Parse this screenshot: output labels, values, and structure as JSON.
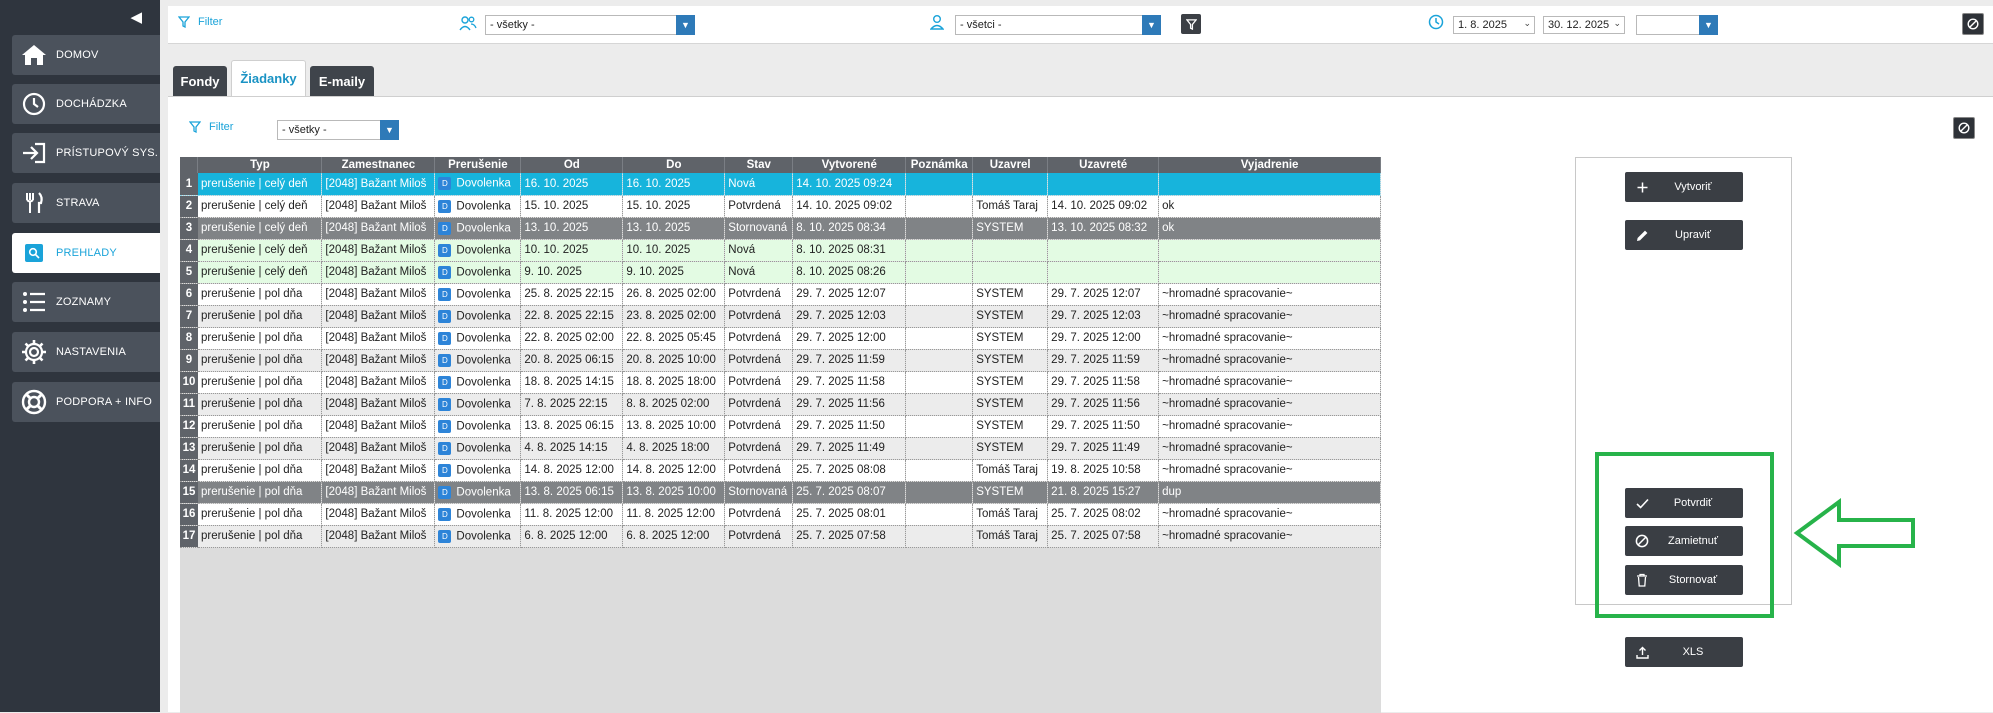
{
  "sidebar": {
    "items": [
      {
        "label": "DOMOV",
        "icon": "home-icon"
      },
      {
        "label": "DOCHÁDZKA",
        "icon": "clock-icon"
      },
      {
        "label": "PRÍSTUPOVÝ SYS.",
        "icon": "login-icon"
      },
      {
        "label": "STRAVA",
        "icon": "cutlery-icon"
      },
      {
        "label": "PREHĽADY",
        "icon": "search-icon"
      },
      {
        "label": "ZOZNAMY",
        "icon": "list-icon"
      },
      {
        "label": "NASTAVENIA",
        "icon": "gear-icon"
      },
      {
        "label": "PODPORA + INFO",
        "icon": "lifebuoy-icon"
      }
    ],
    "active_index": 4
  },
  "topbar": {
    "filter_label": "Filter",
    "group_select": "- všetky -",
    "person_select": "- všetci -",
    "date_from": "1. 8. 2025",
    "date_to": "30. 12. 2025",
    "extra_select": ""
  },
  "tabs": [
    {
      "label": "Fondy",
      "active": false
    },
    {
      "label": "Žiadanky",
      "active": true
    },
    {
      "label": "E-maily",
      "active": false
    }
  ],
  "panel_filter": {
    "label": "Filter",
    "select": "- všetky -"
  },
  "grid": {
    "columns": [
      "Typ",
      "Zamestnanec",
      "Prerušenie",
      "Od",
      "Do",
      "Stav",
      "Vytvorené",
      "Poznámka",
      "Uzavrel",
      "Uzavreté",
      "Vyjadrenie"
    ],
    "rows": [
      {
        "n": "1",
        "typ": "prerušenie | celý deň",
        "emp": "[2048] Bažant Miloš",
        "badge": "D",
        "prer": "Dovolenka",
        "od": "16. 10. 2025",
        "do": "16. 10. 2025",
        "stav": "Nová",
        "vytv": "14. 10. 2025  09:24",
        "pozn": "",
        "uzavrel": "",
        "uzavrete": "",
        "vyj": "",
        "style": "sel"
      },
      {
        "n": "2",
        "typ": "prerušenie | celý deň",
        "emp": "[2048] Bažant Miloš",
        "badge": "D",
        "prer": "Dovolenka",
        "od": "15. 10. 2025",
        "do": "15. 10. 2025",
        "stav": "Potvrdená",
        "vytv": "14. 10. 2025  09:02",
        "pozn": "",
        "uzavrel": "Tomáš Taraj",
        "uzavrete": "14. 10. 2025  09:02",
        "vyj": "ok",
        "style": "white"
      },
      {
        "n": "3",
        "typ": "prerušenie | celý deň",
        "emp": "[2048] Bažant Miloš",
        "badge": "D",
        "prer": "Dovolenka",
        "od": "13. 10. 2025",
        "do": "13. 10. 2025",
        "stav": "Stornovaná",
        "vytv": "8. 10. 2025  08:34",
        "pozn": "",
        "uzavrel": "SYSTEM",
        "uzavrete": "13. 10. 2025  08:32",
        "vyj": "ok",
        "style": "dark"
      },
      {
        "n": "4",
        "typ": "prerušenie | celý deň",
        "emp": "[2048] Bažant Miloš",
        "badge": "D",
        "prer": "Dovolenka",
        "od": "10. 10. 2025",
        "do": "10. 10. 2025",
        "stav": "Nová",
        "vytv": "8. 10. 2025  08:31",
        "pozn": "",
        "uzavrel": "",
        "uzavrete": "",
        "vyj": "",
        "style": "green"
      },
      {
        "n": "5",
        "typ": "prerušenie | celý deň",
        "emp": "[2048] Bažant Miloš",
        "badge": "D",
        "prer": "Dovolenka",
        "od": "9. 10. 2025",
        "do": "9. 10. 2025",
        "stav": "Nová",
        "vytv": "8. 10. 2025  08:26",
        "pozn": "",
        "uzavrel": "",
        "uzavrete": "",
        "vyj": "",
        "style": "green"
      },
      {
        "n": "6",
        "typ": "prerušenie | pol dňa",
        "emp": "[2048] Bažant Miloš",
        "badge": "D",
        "prer": "Dovolenka",
        "od": "25. 8. 2025 22:15",
        "do": "26. 8. 2025 02:00",
        "stav": "Potvrdená",
        "vytv": "29. 7. 2025  12:07",
        "pozn": "",
        "uzavrel": "SYSTEM",
        "uzavrete": "29. 7. 2025  12:07",
        "vyj": "~hromadné spracovanie~",
        "style": "white"
      },
      {
        "n": "7",
        "typ": "prerušenie | pol dňa",
        "emp": "[2048] Bažant Miloš",
        "badge": "D",
        "prer": "Dovolenka",
        "od": "22. 8. 2025 22:15",
        "do": "23. 8. 2025 02:00",
        "stav": "Potvrdená",
        "vytv": "29. 7. 2025  12:03",
        "pozn": "",
        "uzavrel": "SYSTEM",
        "uzavrete": "29. 7. 2025  12:03",
        "vyj": "~hromadné spracovanie~",
        "style": "grey"
      },
      {
        "n": "8",
        "typ": "prerušenie | pol dňa",
        "emp": "[2048] Bažant Miloš",
        "badge": "D",
        "prer": "Dovolenka",
        "od": "22. 8. 2025 02:00",
        "do": "22. 8. 2025 05:45",
        "stav": "Potvrdená",
        "vytv": "29. 7. 2025  12:00",
        "pozn": "",
        "uzavrel": "SYSTEM",
        "uzavrete": "29. 7. 2025  12:00",
        "vyj": "~hromadné spracovanie~",
        "style": "white"
      },
      {
        "n": "9",
        "typ": "prerušenie | pol dňa",
        "emp": "[2048] Bažant Miloš",
        "badge": "D",
        "prer": "Dovolenka",
        "od": "20. 8. 2025 06:15",
        "do": "20. 8. 2025 10:00",
        "stav": "Potvrdená",
        "vytv": "29. 7. 2025  11:59",
        "pozn": "",
        "uzavrel": "SYSTEM",
        "uzavrete": "29. 7. 2025  11:59",
        "vyj": "~hromadné spracovanie~",
        "style": "grey"
      },
      {
        "n": "10",
        "typ": "prerušenie | pol dňa",
        "emp": "[2048] Bažant Miloš",
        "badge": "D",
        "prer": "Dovolenka",
        "od": "18. 8. 2025 14:15",
        "do": "18. 8. 2025 18:00",
        "stav": "Potvrdená",
        "vytv": "29. 7. 2025  11:58",
        "pozn": "",
        "uzavrel": "SYSTEM",
        "uzavrete": "29. 7. 2025  11:58",
        "vyj": "~hromadné spracovanie~",
        "style": "white"
      },
      {
        "n": "11",
        "typ": "prerušenie | pol dňa",
        "emp": "[2048] Bažant Miloš",
        "badge": "D",
        "prer": "Dovolenka",
        "od": "7. 8. 2025 22:15",
        "do": "8. 8. 2025 02:00",
        "stav": "Potvrdená",
        "vytv": "29. 7. 2025  11:56",
        "pozn": "",
        "uzavrel": "SYSTEM",
        "uzavrete": "29. 7. 2025  11:56",
        "vyj": "~hromadné spracovanie~",
        "style": "grey"
      },
      {
        "n": "12",
        "typ": "prerušenie | pol dňa",
        "emp": "[2048] Bažant Miloš",
        "badge": "D",
        "prer": "Dovolenka",
        "od": "13. 8. 2025 06:15",
        "do": "13. 8. 2025 10:00",
        "stav": "Potvrdená",
        "vytv": "29. 7. 2025  11:50",
        "pozn": "",
        "uzavrel": "SYSTEM",
        "uzavrete": "29. 7. 2025  11:50",
        "vyj": "~hromadné spracovanie~",
        "style": "white"
      },
      {
        "n": "13",
        "typ": "prerušenie | pol dňa",
        "emp": "[2048] Bažant Miloš",
        "badge": "D",
        "prer": "Dovolenka",
        "od": "4. 8. 2025 14:15",
        "do": "4. 8. 2025 18:00",
        "stav": "Potvrdená",
        "vytv": "29. 7. 2025  11:49",
        "pozn": "",
        "uzavrel": "SYSTEM",
        "uzavrete": "29. 7. 2025  11:49",
        "vyj": "~hromadné spracovanie~",
        "style": "grey"
      },
      {
        "n": "14",
        "typ": "prerušenie | pol dňa",
        "emp": "[2048] Bažant Miloš",
        "badge": "D",
        "prer": "Dovolenka",
        "od": "14. 8. 2025 12:00",
        "do": "14. 8. 2025 12:00",
        "stav": "Potvrdená",
        "vytv": "25. 7. 2025  08:08",
        "pozn": "",
        "uzavrel": "Tomáš Taraj",
        "uzavrete": "19. 8. 2025  10:58",
        "vyj": "~hromadné spracovanie~",
        "style": "white"
      },
      {
        "n": "15",
        "typ": "prerušenie | pol dňa",
        "emp": "[2048] Bažant Miloš",
        "badge": "D",
        "prer": "Dovolenka",
        "od": "13. 8. 2025 06:15",
        "do": "13. 8. 2025 10:00",
        "stav": "Stornovaná",
        "vytv": "25. 7. 2025  08:07",
        "pozn": "",
        "uzavrel": "SYSTEM",
        "uzavrete": "21. 8. 2025  15:27",
        "vyj": "dup",
        "style": "dark"
      },
      {
        "n": "16",
        "typ": "prerušenie | pol dňa",
        "emp": "[2048] Bažant Miloš",
        "badge": "D",
        "prer": "Dovolenka",
        "od": "11. 8. 2025 12:00",
        "do": "11. 8. 2025 12:00",
        "stav": "Potvrdená",
        "vytv": "25. 7. 2025  08:01",
        "pozn": "",
        "uzavrel": "Tomáš Taraj",
        "uzavrete": "25. 7. 2025  08:02",
        "vyj": "~hromadné spracovanie~",
        "style": "white"
      },
      {
        "n": "17",
        "typ": "prerušenie | pol dňa",
        "emp": "[2048] Bažant Miloš",
        "badge": "D",
        "prer": "Dovolenka",
        "od": "6. 8. 2025 12:00",
        "do": "6. 8. 2025 12:00",
        "stav": "Potvrdená",
        "vytv": "25. 7. 2025  07:58",
        "pozn": "",
        "uzavrel": "Tomáš Taraj",
        "uzavrete": "25. 7. 2025  07:58",
        "vyj": "~hromadné spracovanie~",
        "style": "grey"
      }
    ]
  },
  "actions": {
    "create": "Vytvoriť",
    "edit": "Upraviť",
    "confirm": "Potvrdiť",
    "reject": "Zamietnuť",
    "cancel": "Stornovať",
    "export": "XLS"
  },
  "colors": {
    "accent": "#1aa3d9",
    "highlight": "#27b34a",
    "sidebar": "#2f353e"
  }
}
